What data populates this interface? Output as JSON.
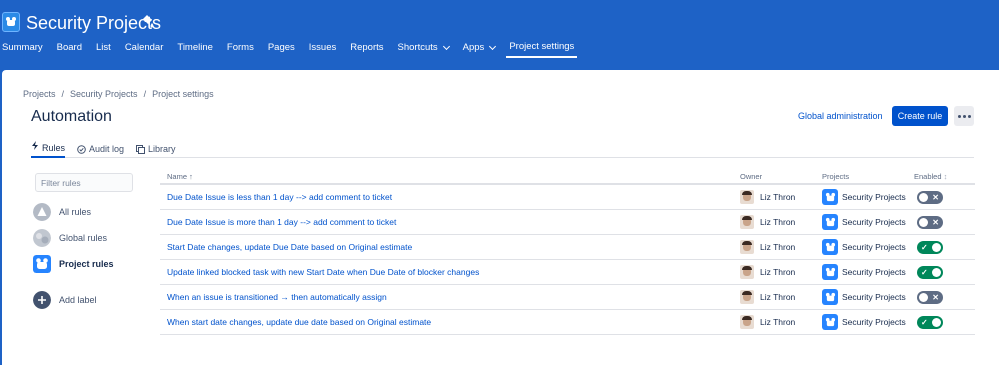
{
  "header": {
    "project_title": "Security Projects",
    "nav": [
      {
        "label": "Summary"
      },
      {
        "label": "Board"
      },
      {
        "label": "List"
      },
      {
        "label": "Calendar"
      },
      {
        "label": "Timeline"
      },
      {
        "label": "Forms"
      },
      {
        "label": "Pages"
      },
      {
        "label": "Issues"
      },
      {
        "label": "Reports"
      },
      {
        "label": "Shortcuts",
        "dropdown": true
      },
      {
        "label": "Apps",
        "dropdown": true
      },
      {
        "label": "Project settings",
        "active": true
      }
    ]
  },
  "breadcrumb": [
    "Projects",
    "Security Projects",
    "Project settings"
  ],
  "page_title": "Automation",
  "actions": {
    "global_admin": "Global administration",
    "create_rule": "Create rule"
  },
  "tabs": [
    {
      "label": "Rules",
      "icon": "lightning-icon",
      "active": true
    },
    {
      "label": "Audit log",
      "icon": "check-circle-icon"
    },
    {
      "label": "Library",
      "icon": "copy-icon"
    }
  ],
  "sidebar": {
    "filter_placeholder": "Filter rules",
    "items": [
      {
        "label": "All rules",
        "icon": "all-rules-icon"
      },
      {
        "label": "Global rules",
        "icon": "globe-icon"
      },
      {
        "label": "Project rules",
        "icon": "project-avatar-icon",
        "active": true
      }
    ],
    "add_label": "Add label"
  },
  "table": {
    "columns": {
      "name": "Name",
      "owner": "Owner",
      "projects": "Projects",
      "enabled": "Enabled"
    },
    "rows": [
      {
        "name": "Due Date Issue is less than 1 day --> add comment to ticket",
        "owner": "Liz Thron",
        "project": "Security Projects",
        "enabled": false
      },
      {
        "name": "Due Date Issue is more than 1 day --> add comment to ticket",
        "owner": "Liz Thron",
        "project": "Security Projects",
        "enabled": false
      },
      {
        "name": "Start Date changes, update Due Date based on Original estimate",
        "owner": "Liz Thron",
        "project": "Security Projects",
        "enabled": true
      },
      {
        "name": "Update linked blocked task with new Start Date when Due Date of blocker changes",
        "owner": "Liz Thron",
        "project": "Security Projects",
        "enabled": true
      },
      {
        "name": "When an issue is transitioned → then automatically assign",
        "owner": "Liz Thron",
        "project": "Security Projects",
        "enabled": false
      },
      {
        "name": "When start date changes, update due date based on Original estimate",
        "owner": "Liz Thron",
        "project": "Security Projects",
        "enabled": true
      }
    ]
  },
  "colors": {
    "brand": "#1e62c6",
    "primary": "#0052cc",
    "toggle_on": "#00875a",
    "toggle_off": "#5e6c84"
  }
}
